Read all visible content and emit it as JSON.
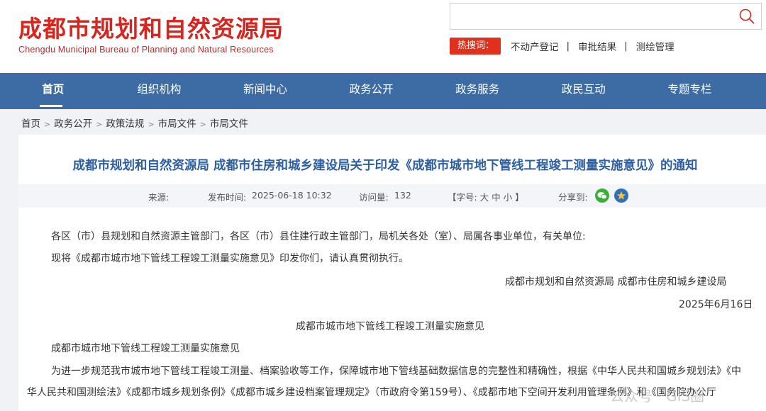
{
  "header": {
    "logo_cn": "成都市规划和自然资源局",
    "logo_en": "Chengdu Municipal Bureau of Planning and Natural Resources",
    "search_placeholder": "",
    "hot_label": "热搜词：",
    "hot_links": [
      "不动产登记",
      "审批结果",
      "测绘管理"
    ],
    "hot_sep": "|"
  },
  "nav": {
    "items": [
      "首页",
      "组织机构",
      "新闻中心",
      "政务公开",
      "政务服务",
      "政民互动",
      "专题专栏"
    ],
    "active_index": 0
  },
  "breadcrumb": {
    "items": [
      "首页",
      "政务公开",
      "政策法规",
      "市局文件",
      "市局文件"
    ],
    "sep": ">"
  },
  "article": {
    "title": "成都市规划和自然资源局 成都市住房和城乡建设局关于印发《成都市城市地下管线工程竣工测量实施意见》的通知",
    "meta": {
      "source_label": "来源:",
      "date_label": "发布时间:",
      "date_value": "2025-06-18 10:32",
      "views_label": "访问量:",
      "views_value": "132",
      "fontsize_label": "【字号:  大  中  小  】",
      "share_label": "分享到:"
    },
    "paragraphs": {
      "addressee": "各区（市）县规划和自然资源主管部门，各区（市）县住建行政主管部门，局机关各处（室）、局属各事业单位，有关单位:",
      "notice": "现将《成都市城市地下管线工程竣工测量实施意见》印发你们，请认真贯彻执行。",
      "signer": "成都市规划和自然资源局 成都市住房和城乡建设局",
      "date": "2025年6月16日",
      "doc_title": "成都市城市地下管线工程竣工测量实施意见",
      "doc_title2": "成都市城市地下管线工程竣工测量实施意见",
      "body1": "为进一步规范我市城市地下管线工程竣工测量、档案验收等工作，保障城市地下管线基础数据信息的完整性和精确性，根据《中华人民共和国城乡规划法》《中",
      "body2": "华人民共和国测绘法》《成都市城乡规划条例》《成都市城乡建设档案管理规定》（市政府令第159号）、《成都市地下空间开发利用管理条例》和《国务院办公厅"
    }
  },
  "watermark": "公众号 · GIS圈",
  "colors": {
    "brand_red": "#d7261f",
    "nav_blue": "#3d6ba3",
    "title_blue": "#2c5ea2"
  }
}
